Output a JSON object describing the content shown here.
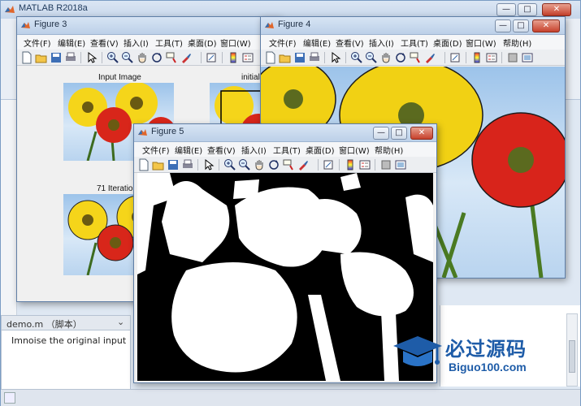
{
  "main_window": {
    "title": "MATLAB R2018a",
    "editor": {
      "file_label": "demo.m （脚本）",
      "text": "Imnoise the original input"
    }
  },
  "figures": {
    "fig3": {
      "title": "Figure 3",
      "menus": [
        "文件(F)",
        "编辑(E)",
        "查看(V)",
        "插入(I)",
        "工具(T)",
        "桌面(D)",
        "窗口(W)"
      ],
      "plot_titles": [
        "Input Image",
        "initial",
        "71 Iteration"
      ]
    },
    "fig4": {
      "title": "Figure 4",
      "menus": [
        "文件(F)",
        "编辑(E)",
        "查看(V)",
        "插入(I)",
        "工具(T)",
        "桌面(D)",
        "窗口(W)",
        "帮助(H)"
      ]
    },
    "fig5": {
      "title": "Figure 5",
      "menus": [
        "文件(F)",
        "编辑(E)",
        "查看(V)",
        "插入(I)",
        "工具(T)",
        "桌面(D)",
        "窗口(W)",
        "帮助(H)"
      ]
    }
  },
  "window_controls": {
    "minimize": "—",
    "maximize": "□",
    "close": "✕"
  },
  "toolbar_icons": [
    "new-figure-icon",
    "open-icon",
    "save-icon",
    "print-icon",
    "edit-plot-icon",
    "zoom-in-icon",
    "zoom-out-icon",
    "pan-icon",
    "rotate-icon",
    "data-cursor-icon",
    "brush-icon",
    "link-icon",
    "colorbar-icon",
    "legend-icon",
    "hide-tools-icon",
    "show-tools-icon"
  ],
  "watermark": {
    "title": "必过源码",
    "subtitle": "Biguo100.com"
  },
  "colors": {
    "titlebar": "#c6d6ea",
    "watermark_blue": "#1e5ca8",
    "figure_bg": "#f0f0f0"
  }
}
